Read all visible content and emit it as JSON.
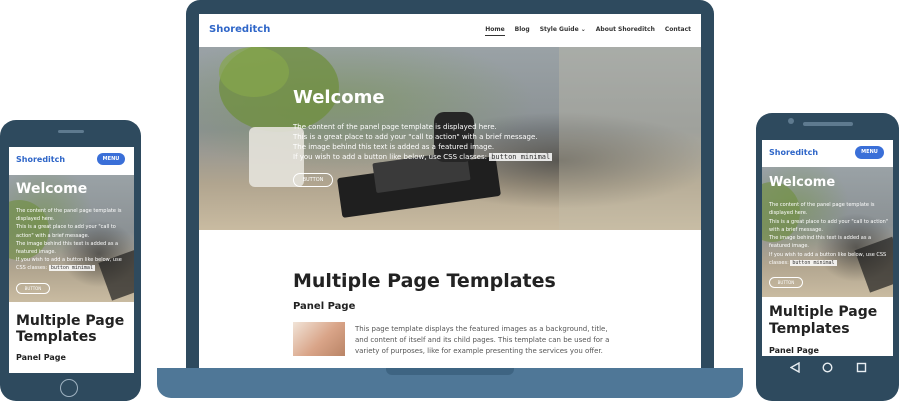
{
  "site": {
    "brand": "Shoreditch",
    "menu_label": "MENU",
    "nav": [
      "Home",
      "Blog",
      "Style Guide",
      "About Shoreditch",
      "Contact"
    ],
    "nav_dropdown_glyph": "⌄",
    "hero": {
      "title": "Welcome",
      "line1": "The content of the panel page template is displayed here.",
      "line2": "This is a great place to add your \"call to action\" with a brief message.",
      "line3": "The image behind this text is added as a featured image.",
      "line4_prefix": "If you wish to add a button like below, use CSS classes:",
      "line4_code": "button minimal",
      "button_label": "BUTTON"
    },
    "content": {
      "title": "Multiple Page Templates",
      "section_title": "Panel Page",
      "paragraph": "This page template displays the featured images as a background, title, and content of itself and its child pages. This template can be used for a variety of purposes, like for example presenting the services you offer."
    }
  },
  "colors": {
    "device_frame": "#2e4a5e",
    "laptop_base": "#4f7797",
    "brand_blue": "#2f66c8",
    "menu_button": "#3a6fd8"
  },
  "icons": {
    "android_back": "back-triangle-icon",
    "android_home": "home-circle-icon",
    "android_recents": "recents-square-icon",
    "iphone_home": "home-button-icon"
  }
}
